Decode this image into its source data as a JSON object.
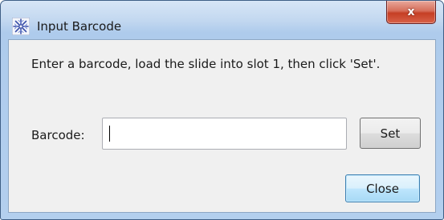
{
  "window": {
    "title": "Input Barcode",
    "close_glyph": "x"
  },
  "dialog": {
    "instruction": "Enter a barcode, load the slide into slot 1, then click 'Set'.",
    "barcode_label": "Barcode:",
    "barcode_value": "",
    "set_label": "Set",
    "close_label": "Close"
  },
  "icons": {
    "app": "snowflake-app-icon",
    "close": "close-icon"
  },
  "colors": {
    "title_gradient_top": "#d7e6f6",
    "title_gradient_bottom": "#aecbec",
    "close_button_red": "#c53e24",
    "client_bg": "#f0f0f0",
    "default_button_blue": "#a7d9f5"
  }
}
